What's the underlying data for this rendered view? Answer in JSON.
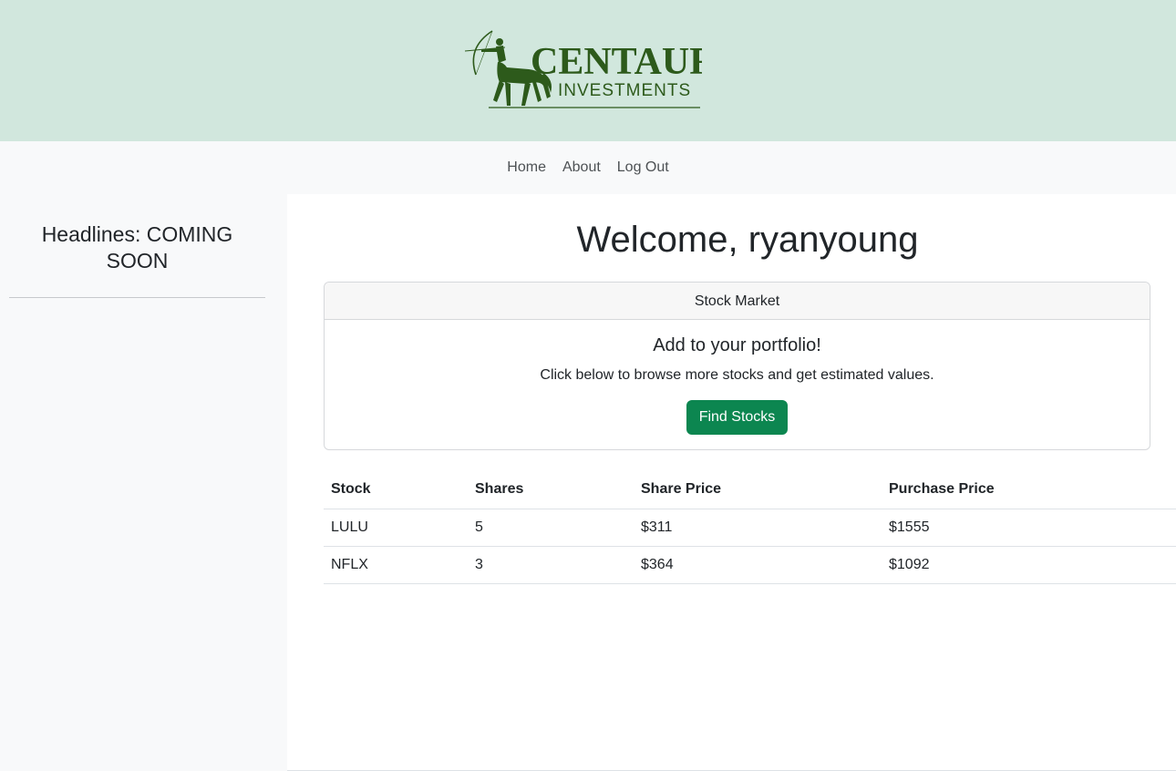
{
  "header": {
    "logo": {
      "title": "CENTAUR",
      "subtitle": "INVESTMENTS",
      "color": "#2d5a1b"
    },
    "background": "#d1e7dd"
  },
  "nav": {
    "items": [
      {
        "label": "Home"
      },
      {
        "label": "About"
      },
      {
        "label": "Log Out"
      }
    ]
  },
  "sidebar": {
    "title": "Headlines: COMING SOON"
  },
  "main": {
    "welcome": "Welcome, ryanyoung",
    "card": {
      "header": "Stock Market",
      "title": "Add to your portfolio!",
      "text": "Click below to browse more stocks and get estimated values.",
      "button_label": "Find Stocks",
      "button_color": "#0c8650"
    },
    "table": {
      "columns": [
        "Stock",
        "Shares",
        "Share Price",
        "Purchase Price"
      ],
      "rows": [
        [
          "LULU",
          "5",
          "$311",
          "$1555"
        ],
        [
          "NFLX",
          "3",
          "$364",
          "$1092"
        ]
      ]
    }
  }
}
